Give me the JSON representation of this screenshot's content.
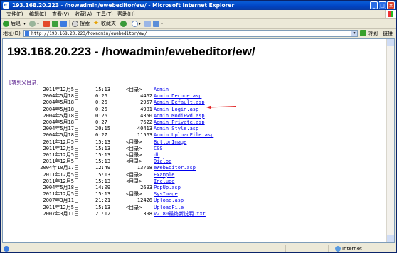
{
  "window": {
    "title": "193.168.20.223 - /howadmin/ewebeditor/ew/ - Microsoft Internet Explorer",
    "minimize": "_",
    "maximize": "□",
    "close": "×"
  },
  "menu": [
    "文件(F)",
    "编辑(E)",
    "查看(V)",
    "收藏(A)",
    "工具(T)",
    "帮助(H)"
  ],
  "toolbar": {
    "back": "后退",
    "search": "搜索",
    "favorites": "收藏夹"
  },
  "addressbar": {
    "label": "地址(D)",
    "url": "http://193.168.20.223/howadmin/ewebeditor/ew/",
    "go": "转到",
    "links": "链接"
  },
  "page": {
    "heading": "193.168.20.223 - /howadmin/ewebeditor/ew/",
    "parent_link": "[转到父目录]",
    "rows": [
      {
        "date": "2011年12月5日",
        "time": "15:13",
        "size": "",
        "dir": "<目录>",
        "name": "Admin"
      },
      {
        "date": "2004年5月18日",
        "time": "0:26",
        "size": "4462",
        "dir": "",
        "name": "Admin_Decode.asp"
      },
      {
        "date": "2004年5月18日",
        "time": "0:26",
        "size": "2957",
        "dir": "",
        "name": "Admin_Default.asp"
      },
      {
        "date": "2004年5月18日",
        "time": "0:26",
        "size": "4981",
        "dir": "",
        "name": "Admin_Login.asp"
      },
      {
        "date": "2004年5月18日",
        "time": "0:26",
        "size": "4350",
        "dir": "",
        "name": "Admin_ModiPwd.asp"
      },
      {
        "date": "2004年5月18日",
        "time": "0:27",
        "size": "7622",
        "dir": "",
        "name": "Admin_Private.asp"
      },
      {
        "date": "2004年5月17日",
        "time": "20:15",
        "size": "40413",
        "dir": "",
        "name": "Admin_Style.asp"
      },
      {
        "date": "2004年5月18日",
        "time": "0:27",
        "size": "11563",
        "dir": "",
        "name": "Admin_UploadFile.asp"
      },
      {
        "date": "2011年12月5日",
        "time": "15:13",
        "size": "",
        "dir": "<目录>",
        "name": "ButtonImage"
      },
      {
        "date": "2011年12月5日",
        "time": "15:13",
        "size": "",
        "dir": "<目录>",
        "name": "CSS"
      },
      {
        "date": "2011年12月5日",
        "time": "15:13",
        "size": "",
        "dir": "<目录>",
        "name": "db"
      },
      {
        "date": "2011年12月5日",
        "time": "15:13",
        "size": "",
        "dir": "<目录>",
        "name": "Dialog"
      },
      {
        "date": "2004年10月17日",
        "time": "12:49",
        "size": "13768",
        "dir": "",
        "name": "eWebEditor.asp"
      },
      {
        "date": "2011年12月5日",
        "time": "15:13",
        "size": "",
        "dir": "<目录>",
        "name": "Example"
      },
      {
        "date": "2011年12月5日",
        "time": "15:13",
        "size": "",
        "dir": "<目录>",
        "name": "Include"
      },
      {
        "date": "2004年5月18日",
        "time": "14:09",
        "size": "2693",
        "dir": "",
        "name": "PopUp.asp"
      },
      {
        "date": "2011年12月5日",
        "time": "15:13",
        "size": "",
        "dir": "<目录>",
        "name": "SysImage"
      },
      {
        "date": "2007年3月11日",
        "time": "21:21",
        "size": "12426",
        "dir": "",
        "name": "Upload.asp"
      },
      {
        "date": "2011年12月5日",
        "time": "15:13",
        "size": "",
        "dir": "<目录>",
        "name": "UploadFile"
      },
      {
        "date": "2007年3月11日",
        "time": "21:12",
        "size": "1398",
        "dir": "",
        "name": "V2.80最终新说明.txt"
      }
    ],
    "highlighted_row": 3
  },
  "status": {
    "zone": "Internet"
  },
  "colors": {
    "titlebar": "#0a5fd8",
    "link": "#0000ee",
    "visited": "#551a8b",
    "arrow": "#e02020"
  }
}
